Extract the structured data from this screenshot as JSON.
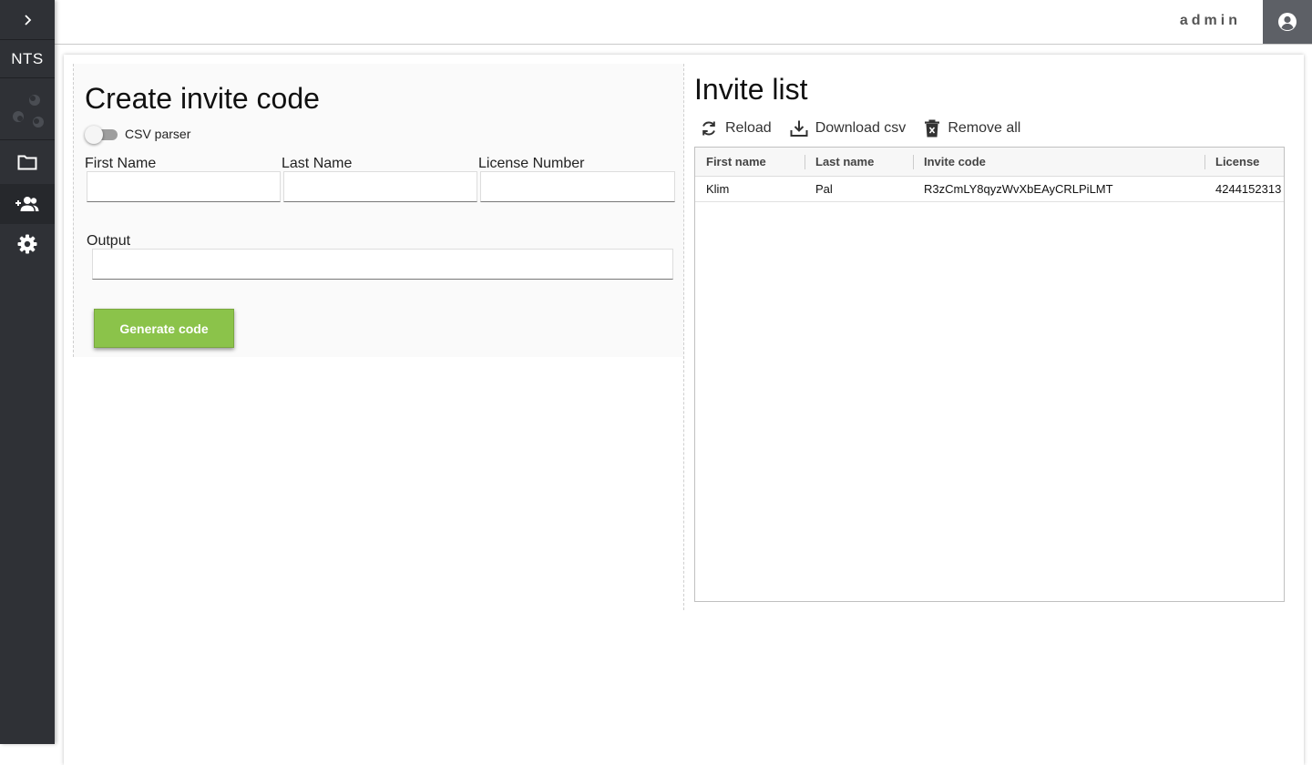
{
  "sidebar": {
    "expand_icon": "chevron-right-icon",
    "brand": "NTS",
    "items": [
      {
        "name": "files",
        "icon": "folder-icon"
      },
      {
        "name": "users",
        "icon": "person-add-icon",
        "active": true
      },
      {
        "name": "settings",
        "icon": "gear-icon"
      }
    ]
  },
  "header": {
    "username": "admin",
    "account_icon": "account-circle-icon"
  },
  "create": {
    "title": "Create invite code",
    "csv_toggle_label": "CSV parser",
    "csv_toggle_on": false,
    "first_name_label": "First Name",
    "last_name_label": "Last Name",
    "license_label": "License Number",
    "first_name_value": "",
    "last_name_value": "",
    "license_value": "",
    "output_label": "Output",
    "output_value": "",
    "generate_label": "Generate code"
  },
  "invites": {
    "title": "Invite list",
    "reload_label": "Reload",
    "download_label": "Download csv",
    "remove_label": "Remove all",
    "columns": [
      "First name",
      "Last name",
      "Invite code",
      "License"
    ],
    "rows": [
      {
        "first": "Klim",
        "last": "Pal",
        "code": "R3zCmLY8qyzWvXbEAyCRLPiLMT",
        "license": "4244152313"
      }
    ]
  },
  "colors": {
    "sidebar_bg": "#2f3136",
    "accent_green": "#8bc34a",
    "account_btn": "#5d6066"
  }
}
